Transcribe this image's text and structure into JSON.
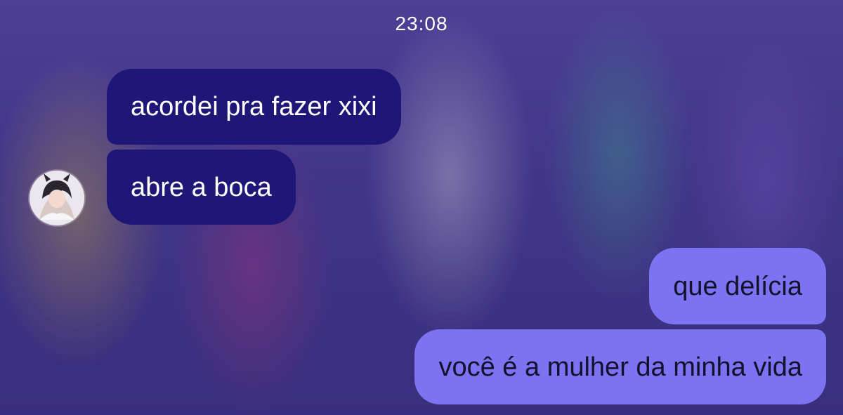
{
  "status": {
    "time": "23:08"
  },
  "messages": [
    {
      "direction": "incoming",
      "text": "acordei pra fazer xixi"
    },
    {
      "direction": "incoming",
      "text": "abre a boca"
    },
    {
      "direction": "outgoing",
      "text": "que delícia"
    },
    {
      "direction": "outgoing",
      "text": "você é a mulher da minha vida"
    }
  ],
  "colors": {
    "incoming_bubble": "#1f1778",
    "outgoing_bubble": "#7b73f2"
  },
  "icons": {
    "avatar": "contact-avatar"
  }
}
